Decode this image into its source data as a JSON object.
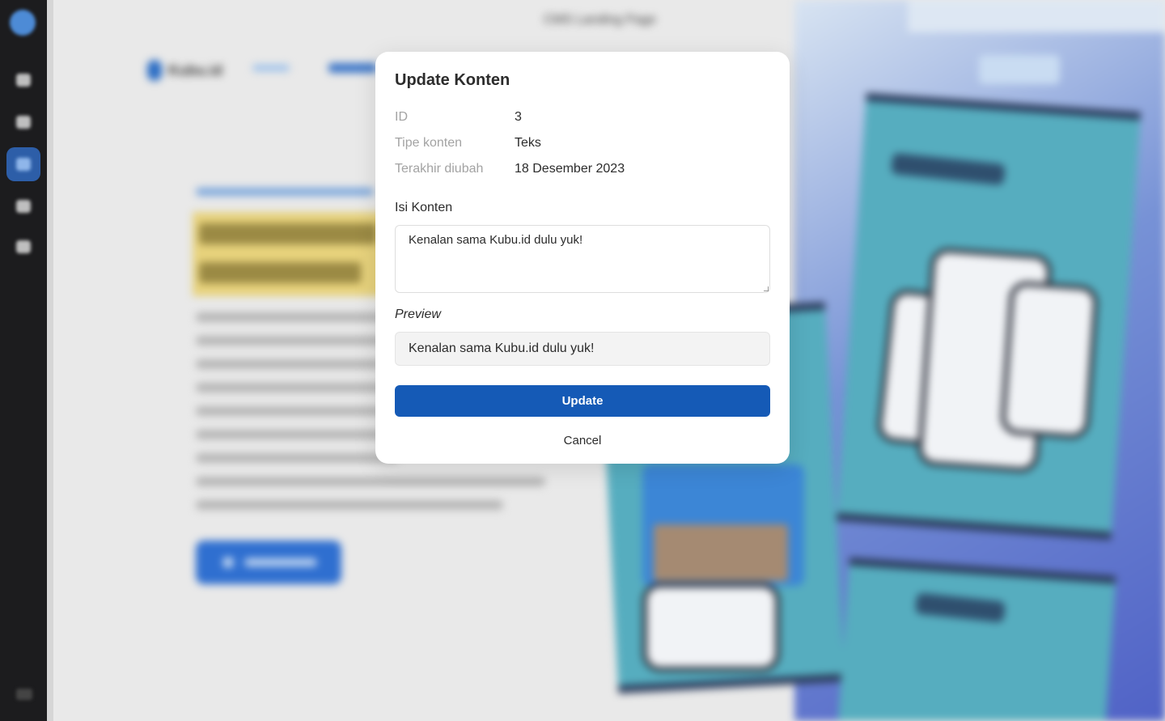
{
  "background_page": {
    "window_title": "CMS Landing Page",
    "brand_name": "Kubu.id"
  },
  "sidebar": {
    "items": [
      {
        "icon": "home-icon"
      },
      {
        "icon": "monitor-icon"
      },
      {
        "icon": "content-icon",
        "active": true
      },
      {
        "icon": "chat-icon"
      },
      {
        "icon": "settings-icon"
      }
    ]
  },
  "modal": {
    "title": "Update Konten",
    "meta": {
      "id_label": "ID",
      "id_value": "3",
      "type_label": "Tipe konten",
      "type_value": "Teks",
      "modified_label": "Terakhir diubah",
      "modified_value": "18 Desember 2023"
    },
    "content_label": "Isi Konten",
    "content_value": "Kenalan sama Kubu.id dulu yuk!",
    "preview_label": "Preview",
    "preview_value": "Kenalan sama Kubu.id dulu yuk!",
    "update_label": "Update",
    "cancel_label": "Cancel"
  },
  "colors": {
    "primary": "#155ab6",
    "sidebar": "#1c1c1e"
  }
}
